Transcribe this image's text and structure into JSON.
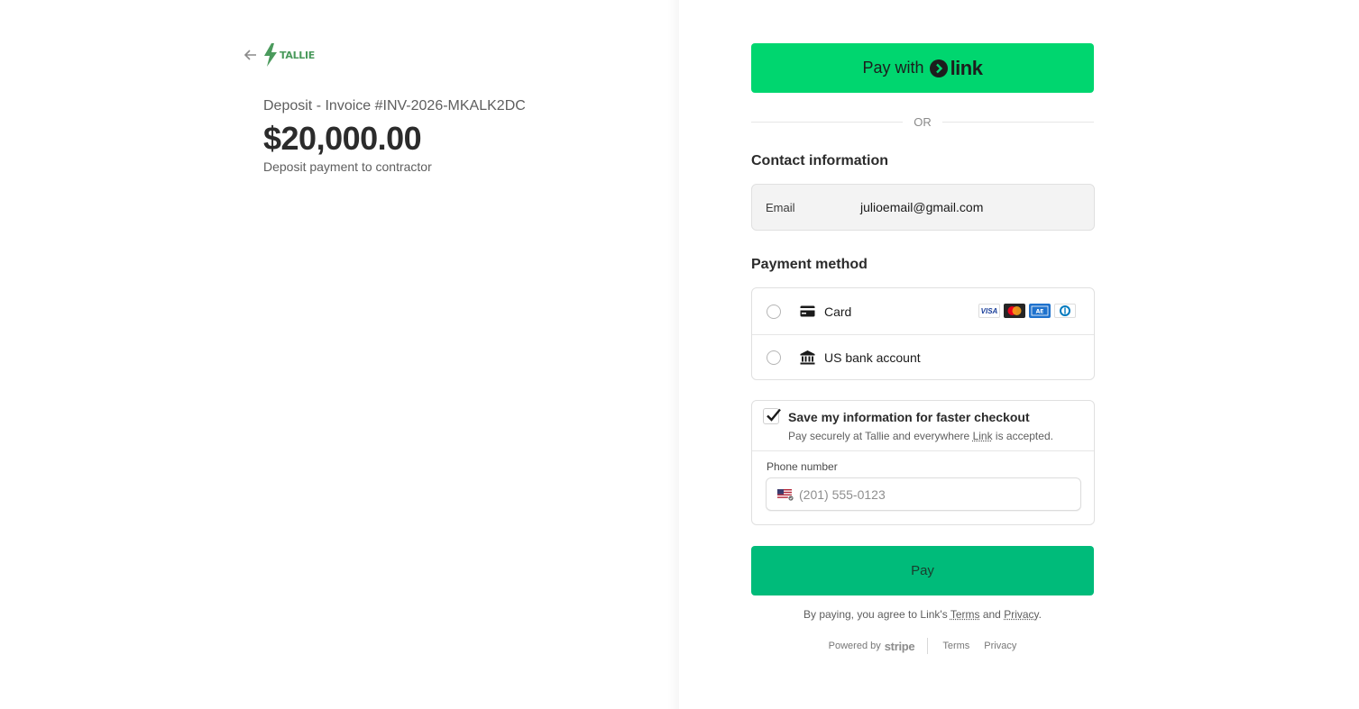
{
  "merchant": {
    "name": "TALLIE",
    "brand_color": "#4a9a5c"
  },
  "summary": {
    "title": "Deposit - Invoice #INV-2026-MKALK2DC",
    "amount": "$20,000.00",
    "description": "Deposit payment to contractor"
  },
  "link_button": {
    "prefix": "Pay with",
    "brand": "link",
    "color": "#00d66f"
  },
  "divider": {
    "text": "OR"
  },
  "contact": {
    "title": "Contact information",
    "email_label": "Email",
    "email_value": "julioemail@gmail.com"
  },
  "payment_method": {
    "title": "Payment method",
    "options": [
      {
        "label": "Card",
        "icon": "credit-card-icon",
        "brands": [
          "VISA",
          "Mastercard",
          "AMEX",
          "Diners"
        ]
      },
      {
        "label": "US bank account",
        "icon": "bank-icon"
      }
    ]
  },
  "save_info": {
    "checked": true,
    "title": "Save my information for faster checkout",
    "sub_prefix": "Pay securely at Tallie and everywhere ",
    "sub_link": "Link",
    "sub_suffix": " is accepted.",
    "phone_label": "Phone number",
    "phone_placeholder": "(201) 555-0123"
  },
  "pay_button": {
    "label": "Pay",
    "color": "#00bb7a"
  },
  "agreement": {
    "prefix": "By paying, you agree to Link's ",
    "terms": "Terms",
    "and": " and ",
    "privacy": "Privacy",
    "suffix": "."
  },
  "footer": {
    "powered_by": "Powered by",
    "brand": "stripe",
    "terms": "Terms",
    "privacy": "Privacy"
  }
}
